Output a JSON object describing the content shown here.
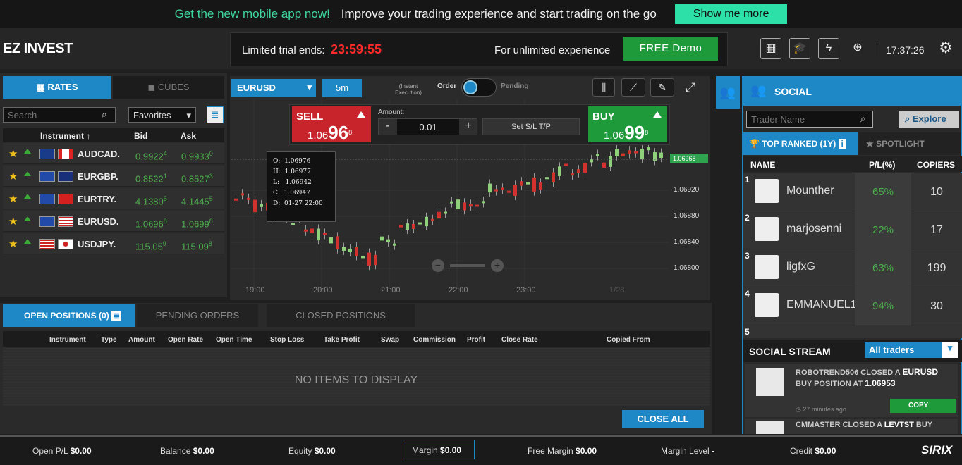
{
  "promo": {
    "text1": "Get the new mobile app now!",
    "text2": "Improve your trading experience and start trading on the go",
    "button": "Show me more"
  },
  "brand": {
    "logo": "EZ INVEST"
  },
  "trial": {
    "label": "Limited trial ends:",
    "timer": "23:59:55",
    "unlimited": "For unlimited experience",
    "demo_button": "FREE Demo"
  },
  "topicons": [
    "calendar-icon",
    "graduation-cap-icon",
    "lightning-icon",
    "plus-circle-icon"
  ],
  "clock": "17:37:26",
  "left_tabs": {
    "rates": "RATES",
    "cubes": "CUBES"
  },
  "search": {
    "placeholder": "Search",
    "filter": "Favorites"
  },
  "rates": {
    "headers": {
      "instrument": "Instrument",
      "bid": "Bid",
      "ask": "Ask"
    },
    "rows": [
      {
        "symbol": "AUDCAD.",
        "bid_main": "0.9922",
        "bid_pip": "4",
        "ask_main": "0.9933",
        "ask_pip": "0"
      },
      {
        "symbol": "EURGBP.",
        "bid_main": "0.8522",
        "bid_pip": "1",
        "ask_main": "0.8527",
        "ask_pip": "3"
      },
      {
        "symbol": "EURTRY.",
        "bid_main": "4.1380",
        "bid_pip": "5",
        "ask_main": "4.1445",
        "ask_pip": "5"
      },
      {
        "symbol": "EURUSD.",
        "bid_main": "1.0696",
        "bid_pip": "8",
        "ask_main": "1.0699",
        "ask_pip": "8"
      },
      {
        "symbol": "USDJPY.",
        "bid_main": "115.05",
        "bid_pip": "9",
        "ask_main": "115.09",
        "ask_pip": "8"
      }
    ]
  },
  "chart": {
    "symbol": "EURUSD",
    "timeframe": "5m",
    "instant": "(Instant Execution)",
    "order": "Order",
    "pending": "Pending",
    "sell_label": "SELL",
    "sell_pre": "1.06",
    "sell_big": "96",
    "sell_sup": "8",
    "buy_label": "BUY",
    "buy_pre": "1.06",
    "buy_big": "99",
    "buy_sup": "8",
    "amount_label": "Amount:",
    "amount_value": "0.01",
    "minus": "-",
    "plus": "+",
    "sl_tp": "Set S/L T/P",
    "ohlc": {
      "O": "1.06976",
      "H": "1.06977",
      "L": "1.06942",
      "C": "1.06947",
      "D": "01-27 22:00"
    },
    "current_price": "1.06968",
    "y_ticks": [
      "1.06920",
      "1.06880",
      "1.06840",
      "1.06800"
    ],
    "x_ticks": [
      "19:00",
      "20:00",
      "21:00",
      "22:00",
      "23:00",
      "1/28"
    ]
  },
  "positions": {
    "tabs": {
      "open": "OPEN POSITIONS (0)",
      "pending": "PENDING ORDERS",
      "closed": "CLOSED POSITIONS"
    },
    "headers": [
      "Instrument",
      "Type",
      "Amount",
      "Open Rate",
      "Open Time",
      "Stop Loss",
      "Take Profit",
      "Swap",
      "Commission",
      "Profit",
      "Close Rate",
      "Copied From"
    ],
    "empty": "NO ITEMS TO DISPLAY",
    "close_all": "CLOSE ALL"
  },
  "bottom": {
    "open_pl": "Open P/L",
    "open_pl_val": "$0.00",
    "balance": "Balance",
    "balance_val": "$0.00",
    "equity": "Equity",
    "equity_val": "$0.00",
    "margin": "Margin",
    "margin_val": "$0.00",
    "free_margin": "Free Margin",
    "free_margin_val": "$0.00",
    "margin_level": "Margin Level",
    "margin_level_val": "-",
    "credit": "Credit",
    "credit_val": "$0.00",
    "brand": "SIRIX"
  },
  "social": {
    "title": "SOCIAL",
    "trader_placeholder": "Trader Name",
    "explore": "Explore",
    "tab_top": "TOP RANKED (1Y)",
    "tab_spotlight": "SPOTLIGHT",
    "headers": {
      "name": "NAME",
      "pl": "P/L(%)",
      "copiers": "COPIERS"
    },
    "traders": [
      {
        "rank": "1",
        "name": "Mounther",
        "pl": "65%",
        "copiers": "10"
      },
      {
        "rank": "2",
        "name": "marjosenni",
        "pl": "22%",
        "copiers": "17"
      },
      {
        "rank": "3",
        "name": "ligfxG",
        "pl": "63%",
        "copiers": "199"
      },
      {
        "rank": "4",
        "name": "EMMANUEL1",
        "pl": "94%",
        "copiers": "30"
      },
      {
        "rank": "5",
        "name": "",
        "pl": "",
        "copiers": ""
      }
    ],
    "stream_title": "SOCIAL STREAM",
    "stream_filter": "All traders",
    "stream": [
      {
        "text": "ROBOTREND506 CLOSED A ",
        "sym": "EURUSD",
        "text2": " BUY POSITION AT ",
        "price": "1.06953",
        "time": "27 minutes ago",
        "copy": "COPY"
      },
      {
        "text": "CMMASTER CLOSED A ",
        "sym": "LEVTST",
        "text2": " BUY",
        "price": "",
        "time": "",
        "copy": ""
      }
    ]
  },
  "colors": {
    "accent": "#1e88c7",
    "sell": "#c8242c",
    "buy": "#1f9a3a",
    "green_text": "#4cae4c"
  }
}
